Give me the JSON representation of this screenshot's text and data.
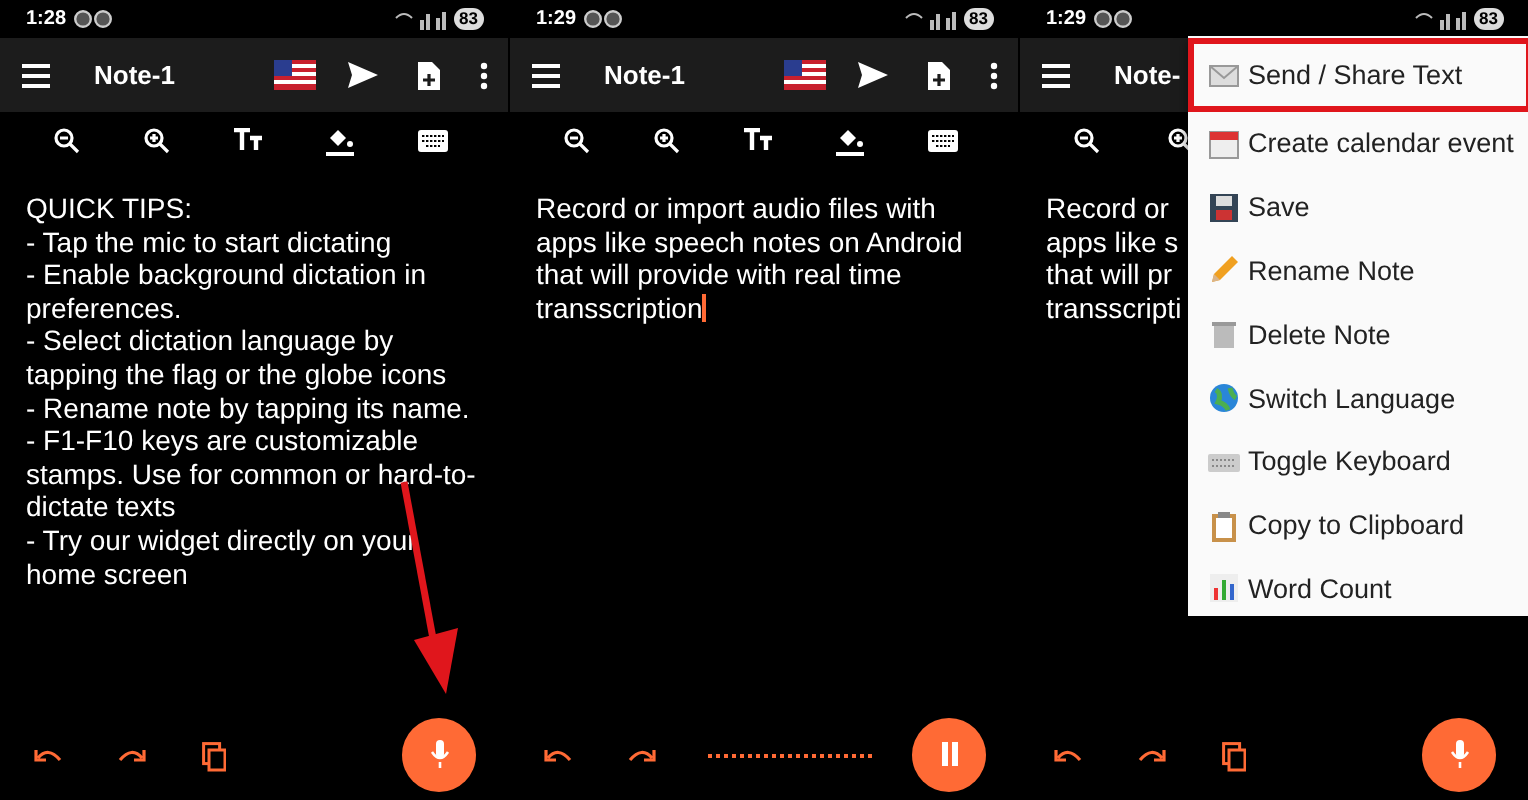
{
  "panels": [
    {
      "status": {
        "time": "1:28",
        "battery": "83"
      },
      "title": "Note-1",
      "lines": [
        "QUICK TIPS:",
        "- Tap the mic to start dictating",
        "- Enable background dictation in preferences.",
        "- Select dictation language by tapping the flag or the globe icons",
        "- Rename note by tapping its name.",
        "- F1-F10 keys are customizable stamps. Use for common or hard-to-dictate texts",
        "- Try our widget directly on your home screen"
      ],
      "recording": false,
      "arrow": true
    },
    {
      "status": {
        "time": "1:29",
        "battery": "83"
      },
      "title": "Note-1",
      "lines": [
        "Record or import audio files with apps like speech notes on Android that will provide with real time transscription"
      ],
      "cursor": true,
      "recording": true
    },
    {
      "status": {
        "time": "1:29",
        "battery": "83"
      },
      "title": "Note-",
      "lines": [
        "Record or",
        "apps like s",
        "that will pr",
        "transscripti"
      ],
      "recording": false,
      "menu": [
        {
          "label": "Send / Share Text",
          "highlighted": true
        },
        {
          "label": "Create calendar event",
          "highlighted": false
        },
        {
          "label": "Save",
          "highlighted": false
        },
        {
          "label": "Rename Note",
          "highlighted": false
        },
        {
          "label": "Delete Note",
          "highlighted": false
        },
        {
          "label": "Switch Language",
          "highlighted": false
        },
        {
          "label": "Toggle Keyboard",
          "highlighted": false
        },
        {
          "label": "Copy to Clipboard",
          "highlighted": false
        },
        {
          "label": "Word Count",
          "highlighted": false
        }
      ]
    }
  ]
}
